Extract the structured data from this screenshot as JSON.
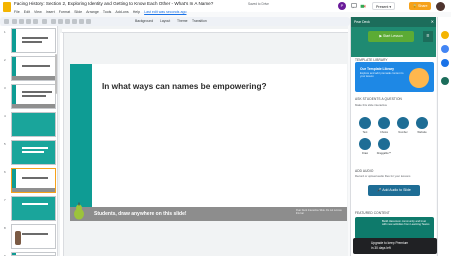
{
  "titlebar": {
    "title": "Facing History: Section 2, Exploring Identity and Getting to Know Each Other - What's In A Name?",
    "saved": "Saved to Drive",
    "present": "Present",
    "share": "Share",
    "profile_initial": "P"
  },
  "menu": [
    "File",
    "Edit",
    "View",
    "Insert",
    "Format",
    "Slide",
    "Arrange",
    "Tools",
    "Add-ons",
    "Help"
  ],
  "last_edit": "Last edit was seconds ago",
  "toolbar": {
    "background": "Background",
    "layout": "Layout",
    "theme": "Theme",
    "transition": "Transition"
  },
  "filmstrip": {
    "slide_numbers": [
      "1",
      "2",
      "3",
      "4",
      "5",
      "6",
      "7",
      "8",
      "9"
    ]
  },
  "slide": {
    "heading": "In what ways can names be empowering?",
    "footer": "Students, draw anywhere on this slide!",
    "footer_note": "Pear Deck Interactive Slide. Do not remove this bar"
  },
  "panel": {
    "title": "Pear Deck",
    "start_button": "Start Lesson",
    "template_library_title": "TEMPLATE LIBRARY",
    "library_card_title": "Our Template Library",
    "library_card_desc": "Explore and add premade content to your lesson",
    "ask_title": "ASK STUDENTS A QUESTION",
    "ask_desc": "Make this slide interactive",
    "question_types": [
      "Text",
      "Choice",
      "Number",
      "Website",
      "Draw",
      "Draggable™"
    ],
    "audio_title": "ADD AUDIO",
    "audio_desc": "Record or upload audio files for your lessons",
    "audio_button": "Add Audio to Slide",
    "featured_title": "FEATURED CONTENT",
    "featured_text": "Build classroom community and trust with new activities from Learning Teams"
  },
  "upgrade": {
    "line1": "Upgrade to keep Premium",
    "line2": "in 30 days left"
  },
  "colors": {
    "teal": "#0e9c94",
    "pear_green": "#5cab35",
    "share_orange": "#f6a21b"
  }
}
